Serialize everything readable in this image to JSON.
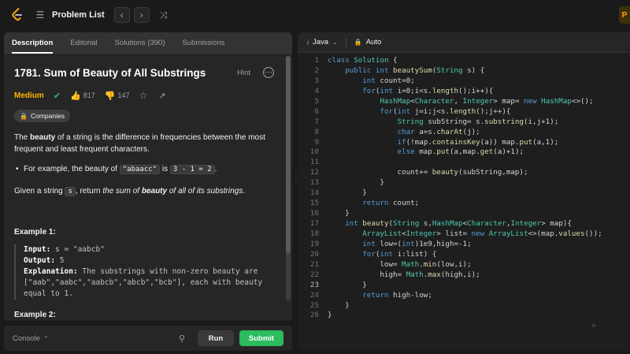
{
  "topbar": {
    "problem_list_label": "Problem List",
    "prev_glyph": "‹",
    "next_glyph": "›",
    "shuffle_glyph": "⤨",
    "premium_glyph": "P"
  },
  "tabs": [
    {
      "label": "Description"
    },
    {
      "label": "Editorial"
    },
    {
      "label": "Solutions (390)"
    },
    {
      "label": "Submissions"
    }
  ],
  "problem": {
    "title": "1781. Sum of Beauty of All Substrings",
    "hint": "Hint",
    "difficulty": "Medium",
    "likes": "817",
    "dislikes": "147",
    "companies": "Companies",
    "para1_pre": "The ",
    "para1_bold": "beauty",
    "para1_post": " of a string is the difference in frequencies between the most frequent and least frequent characters.",
    "bullet_pre": "For example, the beauty of ",
    "bullet_code1": "\"abaacc\"",
    "bullet_mid": " is ",
    "bullet_code2": "3 - 1 = 2",
    "bullet_post": ".",
    "para2_pre": "Given a string ",
    "para2_code": "s",
    "para2_mid": ", return ",
    "para2_em": "the sum of ",
    "para2_em_bold": "beauty",
    "para2_em2": " of all of its substrings.",
    "example1_title": "Example 1:",
    "input_label": "Input:",
    "input_value": " s = \"aabcb\"",
    "output_label": "Output:",
    "output_value": " 5",
    "explanation_label": "Explanation:",
    "explanation_value": " The substrings with non-zero beauty are [\"aab\",\"aabc\",\"aabcb\",\"abcb\",\"bcb\"], each with beauty equal to 1.",
    "example2_title": "Example 2:"
  },
  "console": {
    "label": "Console",
    "run": "Run",
    "submit": "Submit"
  },
  "editor": {
    "language": "Java",
    "mode": "Auto",
    "active_line": 23
  },
  "code_lines": [
    "class Solution {",
    "    public int beautySum(String s) {",
    "        int count=0;",
    "        for(int i=0;i<s.length();i++){",
    "            HashMap<Character, Integer> map= new HashMap<>();",
    "            for(int j=i;j<s.length();j++){",
    "                String subString= s.substring(i,j+1);",
    "                char a=s.charAt(j);",
    "                if(!map.containsKey(a)) map.put(a,1);",
    "                else map.put(a,map.get(a)+1);",
    "",
    "                count+= beauty(subString,map);",
    "            }",
    "        }",
    "        return count;",
    "    }",
    "    int beauty(String s,HashMap<Character,Integer> map){",
    "        ArrayList<Integer> list= new ArrayList<>(map.values());",
    "        int low=(int)1e9,high=-1;",
    "        for(int i:list) {",
    "            low= Math.min(low,i);",
    "            high= Math.max(high,i);",
    "        }",
    "        return high-low;",
    "    }",
    "}"
  ]
}
